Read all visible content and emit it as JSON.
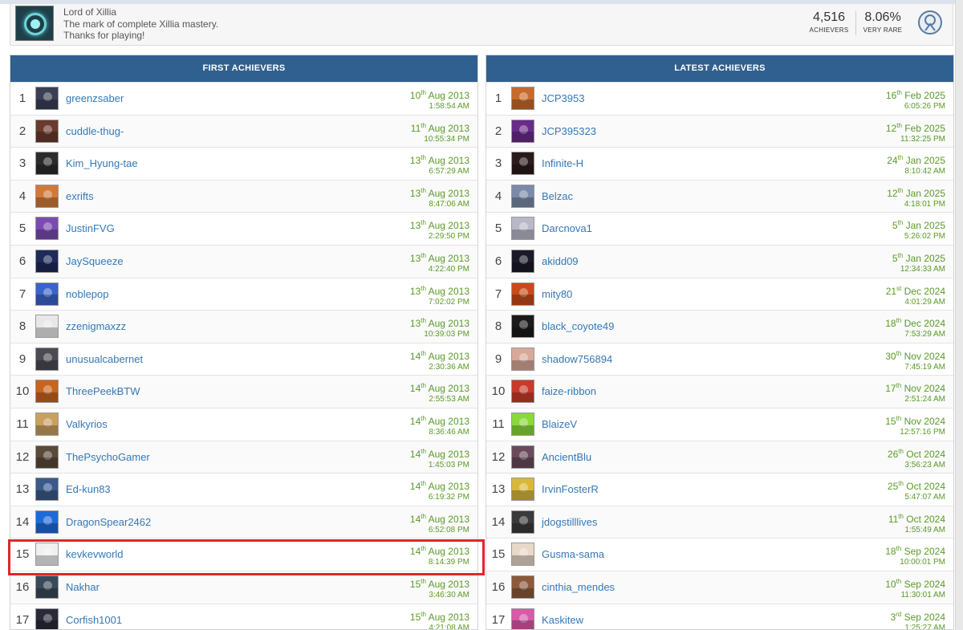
{
  "trophy": {
    "title": "Lord of Xillia",
    "description": "The mark of complete Xillia mastery.",
    "thanks": "Thanks for playing!",
    "achievers_count": "4,516",
    "achievers_label": "ACHIEVERS",
    "rarity_value": "8.06%",
    "rarity_label": "VERY RARE",
    "icon": "trophy-xillia-emblem",
    "grade_icon": "platinum-trophy-icon"
  },
  "panels": {
    "first": {
      "title": "FIRST ACHIEVERS",
      "rows": [
        {
          "rank": "1",
          "name": "greenzsaber",
          "day": "10",
          "suffix": "th",
          "month": "Aug 2013",
          "time": "1:58:54 AM",
          "color": "#3a3f55"
        },
        {
          "rank": "2",
          "name": "cuddle-thug-",
          "day": "11",
          "suffix": "th",
          "month": "Aug 2013",
          "time": "10:55:34 PM",
          "color": "#6b3a2e"
        },
        {
          "rank": "3",
          "name": "Kim_Hyung-tae",
          "day": "13",
          "suffix": "th",
          "month": "Aug 2013",
          "time": "6:57:29 AM",
          "color": "#2b2b2b"
        },
        {
          "rank": "4",
          "name": "exrifts",
          "day": "13",
          "suffix": "th",
          "month": "Aug 2013",
          "time": "8:47:06 AM",
          "color": "#d07a3a"
        },
        {
          "rank": "5",
          "name": "JustinFVG",
          "day": "13",
          "suffix": "th",
          "month": "Aug 2013",
          "time": "2:29:50 PM",
          "color": "#7a4bb0"
        },
        {
          "rank": "6",
          "name": "JaySqueeze",
          "day": "13",
          "suffix": "th",
          "month": "Aug 2013",
          "time": "4:22:40 PM",
          "color": "#1e2a5a"
        },
        {
          "rank": "7",
          "name": "noblepop",
          "day": "13",
          "suffix": "th",
          "month": "Aug 2013",
          "time": "7:02:02 PM",
          "color": "#3a64c8"
        },
        {
          "rank": "8",
          "name": "zzenigmaxzz",
          "day": "13",
          "suffix": "th",
          "month": "Aug 2013",
          "time": "10:39:03 PM",
          "color": "#e8e8e8"
        },
        {
          "rank": "9",
          "name": "unusualcabernet",
          "day": "14",
          "suffix": "th",
          "month": "Aug 2013",
          "time": "2:30:36 AM",
          "color": "#4a4a52"
        },
        {
          "rank": "10",
          "name": "ThreePeekBTW",
          "day": "14",
          "suffix": "th",
          "month": "Aug 2013",
          "time": "2:55:53 AM",
          "color": "#c8641e"
        },
        {
          "rank": "11",
          "name": "Valkyrios",
          "day": "14",
          "suffix": "th",
          "month": "Aug 2013",
          "time": "8:36:46 AM",
          "color": "#c8a060"
        },
        {
          "rank": "12",
          "name": "ThePsychoGamer",
          "day": "14",
          "suffix": "th",
          "month": "Aug 2013",
          "time": "1:45:03 PM",
          "color": "#5a4a3a"
        },
        {
          "rank": "13",
          "name": "Ed-kun83",
          "day": "14",
          "suffix": "th",
          "month": "Aug 2013",
          "time": "6:19:32 PM",
          "color": "#3a5a8a"
        },
        {
          "rank": "14",
          "name": "DragonSpear2462",
          "day": "14",
          "suffix": "th",
          "month": "Aug 2013",
          "time": "6:52:08 PM",
          "color": "#1e6ad8"
        },
        {
          "rank": "15",
          "name": "kevkevworld",
          "day": "14",
          "suffix": "th",
          "month": "Aug 2013",
          "time": "8:14:39 PM",
          "color": "#f0f0f0"
        },
        {
          "rank": "16",
          "name": "Nakhar",
          "day": "15",
          "suffix": "th",
          "month": "Aug 2013",
          "time": "3:46:30 AM",
          "color": "#3a4a5a"
        },
        {
          "rank": "17",
          "name": "Corfish1001",
          "day": "15",
          "suffix": "th",
          "month": "Aug 2013",
          "time": "4:21:08 AM",
          "color": "#2a2a3a"
        }
      ]
    },
    "latest": {
      "title": "LATEST ACHIEVERS",
      "rows": [
        {
          "rank": "1",
          "name": "JCP3953",
          "day": "16",
          "suffix": "th",
          "month": "Feb 2025",
          "time": "6:05:26 PM",
          "color": "#c86a2a"
        },
        {
          "rank": "2",
          "name": "JCP395323",
          "day": "12",
          "suffix": "th",
          "month": "Feb 2025",
          "time": "11:32:25 PM",
          "color": "#6a2a8a"
        },
        {
          "rank": "3",
          "name": "Infinite-H",
          "day": "24",
          "suffix": "th",
          "month": "Jan 2025",
          "time": "8:10:42 AM",
          "color": "#2a1a1a"
        },
        {
          "rank": "4",
          "name": "Belzac",
          "day": "12",
          "suffix": "th",
          "month": "Jan 2025",
          "time": "4:18:01 PM",
          "color": "#7a8aa8"
        },
        {
          "rank": "5",
          "name": "Darcnova1",
          "day": "5",
          "suffix": "th",
          "month": "Jan 2025",
          "time": "5:26:02 PM",
          "color": "#b8b8c8"
        },
        {
          "rank": "6",
          "name": "akidd09",
          "day": "5",
          "suffix": "th",
          "month": "Jan 2025",
          "time": "12:34:33 AM",
          "color": "#1a1a2a"
        },
        {
          "rank": "7",
          "name": "mity80",
          "day": "21",
          "suffix": "st",
          "month": "Dec 2024",
          "time": "4:01:29 AM",
          "color": "#c84a1a"
        },
        {
          "rank": "8",
          "name": "black_coyote49",
          "day": "18",
          "suffix": "th",
          "month": "Dec 2024",
          "time": "7:53:29 AM",
          "color": "#1a1a1a"
        },
        {
          "rank": "9",
          "name": "shadow756894",
          "day": "30",
          "suffix": "th",
          "month": "Nov 2024",
          "time": "7:45:19 AM",
          "color": "#d8a898"
        },
        {
          "rank": "10",
          "name": "faize-ribbon",
          "day": "17",
          "suffix": "th",
          "month": "Nov 2024",
          "time": "2:51:24 AM",
          "color": "#c83a2a"
        },
        {
          "rank": "11",
          "name": "BlaizeV",
          "day": "15",
          "suffix": "th",
          "month": "Nov 2024",
          "time": "12:57:16 PM",
          "color": "#8ad83a"
        },
        {
          "rank": "12",
          "name": "AncientBlu",
          "day": "26",
          "suffix": "th",
          "month": "Oct 2024",
          "time": "3:56:23 AM",
          "color": "#6a4a5a"
        },
        {
          "rank": "13",
          "name": "IrvinFosterR",
          "day": "25",
          "suffix": "th",
          "month": "Oct 2024",
          "time": "5:47:07 AM",
          "color": "#d8b83a"
        },
        {
          "rank": "14",
          "name": "jdogstilllives",
          "day": "11",
          "suffix": "th",
          "month": "Oct 2024",
          "time": "1:55:49 AM",
          "color": "#3a3a3a"
        },
        {
          "rank": "15",
          "name": "Gusma-sama",
          "day": "18",
          "suffix": "th",
          "month": "Sep 2024",
          "time": "10:00:01 PM",
          "color": "#e8d8c8"
        },
        {
          "rank": "16",
          "name": "cinthia_mendes",
          "day": "10",
          "suffix": "th",
          "month": "Sep 2024",
          "time": "11:30:01 AM",
          "color": "#8a5a3a"
        },
        {
          "rank": "17",
          "name": "Kaskitew",
          "day": "3",
          "suffix": "rd",
          "month": "Sep 2024",
          "time": "1:25:27 AM",
          "color": "#d85aa8"
        }
      ]
    }
  },
  "highlight": {
    "panel": "first",
    "rank": "15",
    "color": "#e0262c"
  }
}
